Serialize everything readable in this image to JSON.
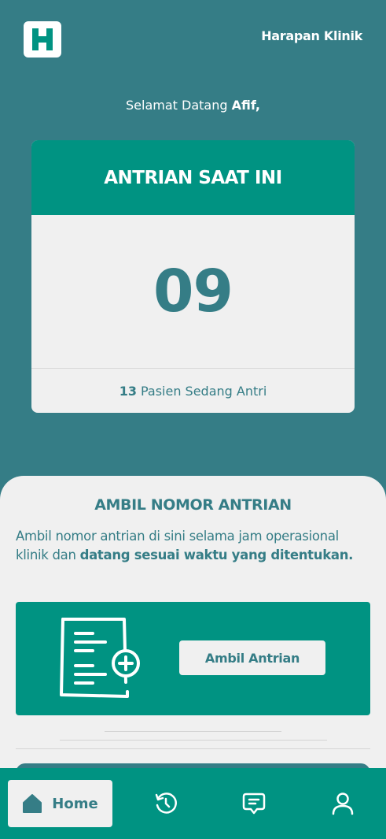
{
  "header": {
    "logo_letter": "H",
    "clinic_name": "Harapan Klinik"
  },
  "welcome": {
    "greeting": "Selamat Datang",
    "user_name": "Afif,"
  },
  "queue_card": {
    "title": "ANTRIAN SAAT INI",
    "current_number": "09",
    "waiting_count": "13",
    "waiting_label": "Pasien Sedang Antri"
  },
  "take_number": {
    "title": "AMBIL NOMOR ANTRIAN",
    "description_plain": "Ambil nomor antrian di sini selama jam operasional klinik dan",
    "description_bold": "datang sesuai waktu yang ditentukan.",
    "button_label": "Ambil Antrian",
    "icon": "document-add-icon"
  },
  "bottom_nav": {
    "items": [
      {
        "label": "Home",
        "icon": "home-icon",
        "active": true
      },
      {
        "label": "",
        "icon": "history-icon",
        "active": false
      },
      {
        "label": "",
        "icon": "chat-icon",
        "active": false
      },
      {
        "label": "",
        "icon": "user-icon",
        "active": false
      }
    ]
  },
  "colors": {
    "background": "#357d86",
    "accent": "#009382",
    "card": "#f0f0f0",
    "text_primary": "#357d86"
  }
}
